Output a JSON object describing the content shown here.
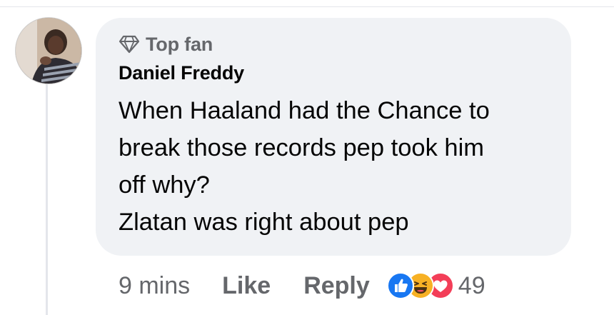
{
  "comment": {
    "badge": {
      "icon": "diamond-icon",
      "label": "Top fan"
    },
    "author": "Daniel Freddy",
    "text_lines": [
      "When Haaland had the Chance to",
      "break those records pep took him",
      "off why?",
      "Zlatan was right about pep"
    ],
    "time": "9 mins",
    "actions": {
      "like": "Like",
      "reply": "Reply"
    },
    "reactions": {
      "icons": [
        "like-reaction-icon",
        "haha-reaction-icon",
        "love-reaction-icon"
      ],
      "count": "49"
    }
  },
  "colors": {
    "bubble_background": "#f0f2f5",
    "secondary_text": "#65676b",
    "primary_text": "#050505",
    "like_blue": "#1877f2",
    "haha_yellow": "#f7b125",
    "love_red": "#f33e58"
  }
}
